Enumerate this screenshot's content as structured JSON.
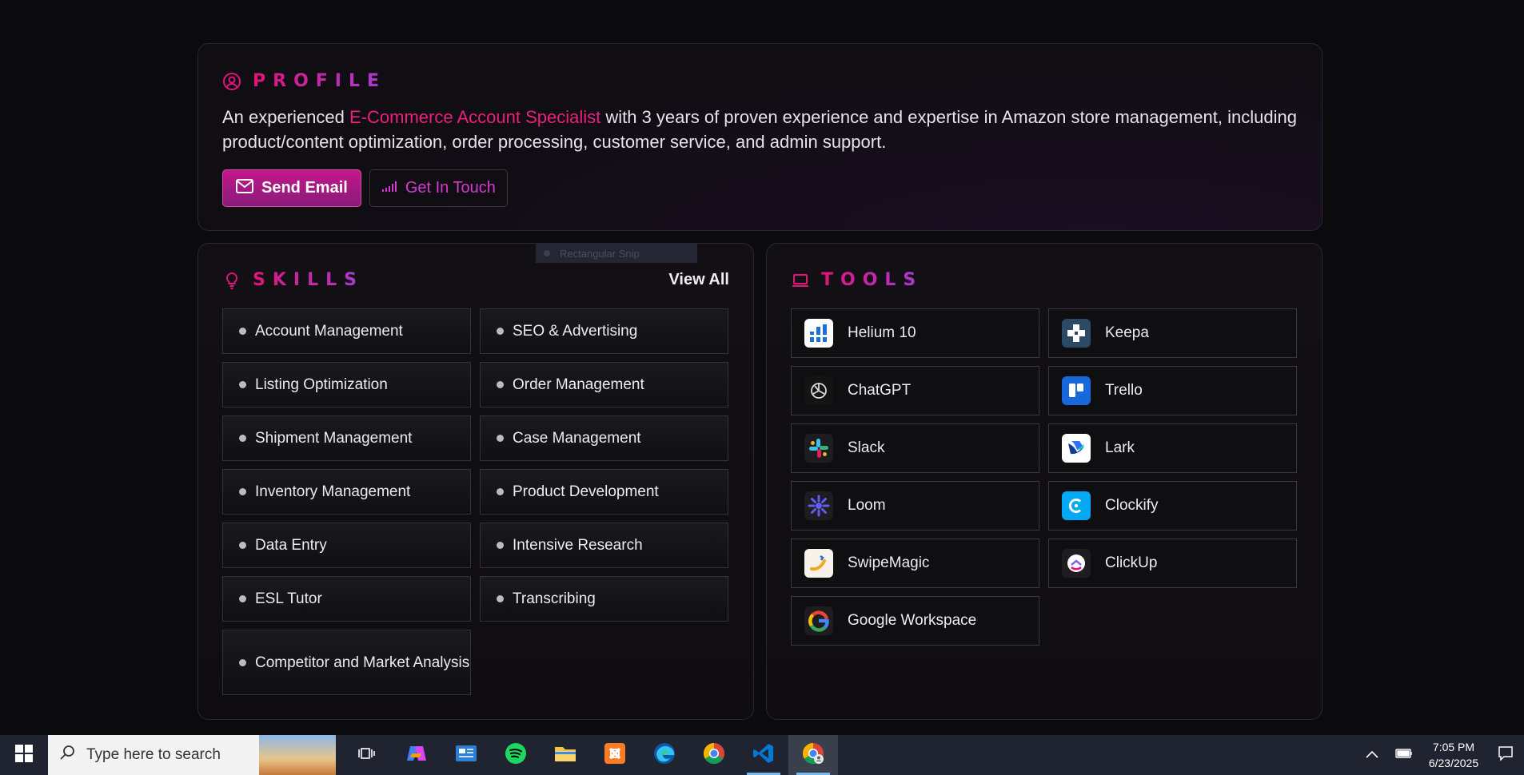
{
  "profile": {
    "title": "PROFILE",
    "text_pre": "An experienced ",
    "text_highlight": "E-Commerce Account Specialist",
    "text_post": " with 3 years of proven experience and expertise in Amazon store management, including product/content optimization, order processing, customer service, and admin support.",
    "send_email_label": "Send Email",
    "get_in_touch_label": "Get In Touch"
  },
  "skills": {
    "title": "SKILLS",
    "view_all_label": "View All",
    "snip_overlay_label": "Rectangular Snip",
    "items": [
      "Account Management",
      "SEO & Advertising",
      "Listing Optimization",
      "Order Management",
      "Shipment Management",
      "Case Management",
      "Inventory Management",
      "Product Development",
      "Data Entry",
      "Intensive Research",
      "ESL Tutor",
      "Transcribing",
      "Competitor and Market Analysis"
    ]
  },
  "tools": {
    "title": "TOOLS",
    "items": [
      {
        "name": "Helium 10",
        "icon": "helium10-icon"
      },
      {
        "name": "Keepa",
        "icon": "keepa-icon"
      },
      {
        "name": "ChatGPT",
        "icon": "chatgpt-icon"
      },
      {
        "name": "Trello",
        "icon": "trello-icon"
      },
      {
        "name": "Slack",
        "icon": "slack-icon"
      },
      {
        "name": "Lark",
        "icon": "lark-icon"
      },
      {
        "name": "Loom",
        "icon": "loom-icon"
      },
      {
        "name": "Clockify",
        "icon": "clockify-icon"
      },
      {
        "name": "SwipeMagic",
        "icon": "swipemagic-icon"
      },
      {
        "name": "ClickUp",
        "icon": "clickup-icon"
      },
      {
        "name": "Google Workspace",
        "icon": "google-icon"
      }
    ]
  },
  "taskbar": {
    "search_placeholder": "Type here to search",
    "time": "7:05 PM",
    "date": "6/23/2025",
    "apps": [
      "task-view",
      "copilot",
      "news",
      "spotify",
      "file-explorer",
      "xampp",
      "edge",
      "chrome",
      "vscode",
      "chrome-profile"
    ]
  },
  "colors": {
    "accent_pink": "#ec1f7e",
    "accent_purple": "#a83bd6",
    "background": "#0b0a0c"
  }
}
